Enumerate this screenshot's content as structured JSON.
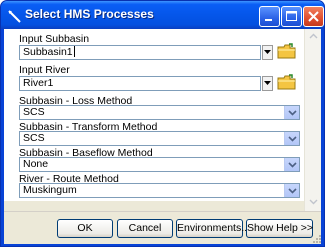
{
  "window": {
    "title": "Select HMS Processes",
    "accent": "#0843d6"
  },
  "fields": {
    "subbasin": {
      "label": "Input Subbasin",
      "value": "Subbasin1"
    },
    "river": {
      "label": "Input River",
      "value": "River1"
    },
    "loss": {
      "label": "Subbasin - Loss Method",
      "value": "SCS"
    },
    "transform": {
      "label": "Subbasin - Transform Method",
      "value": "SCS"
    },
    "baseflow": {
      "label": "Subbasin - Baseflow Method",
      "value": "None"
    },
    "route": {
      "label": "River - Route Method",
      "value": "Muskingum"
    }
  },
  "buttons": {
    "ok": "OK",
    "cancel": "Cancel",
    "environments": "Environments...",
    "help": "Show Help >>"
  },
  "icons": [
    "app-icon",
    "minimize-icon",
    "maximize-icon",
    "close-icon",
    "folder-icon",
    "chevron-down-icon"
  ]
}
